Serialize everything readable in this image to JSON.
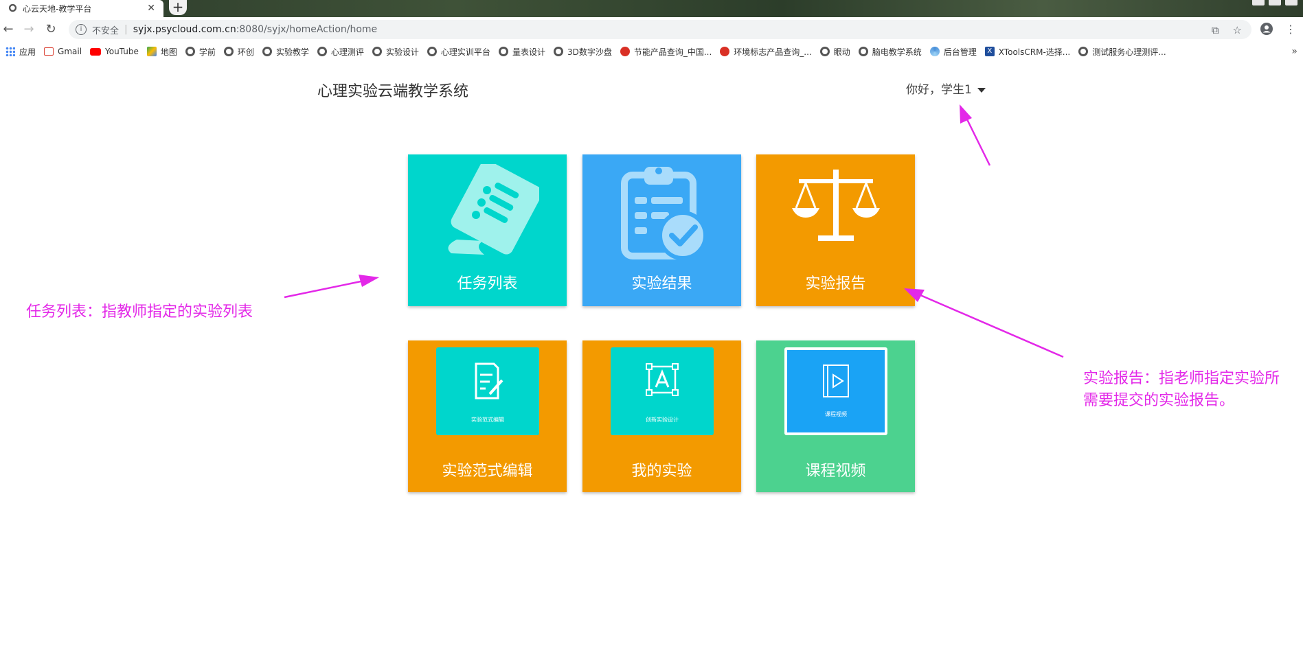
{
  "browser": {
    "tab_title": "心云天地-教学平台",
    "tab_close": "✕",
    "new_tab": "+",
    "address": {
      "security_label": "不安全",
      "url_host": "syjx.psycloud.com.cn",
      "url_path": ":8080/syjx/homeAction/home"
    },
    "bookmarks": [
      {
        "label": "应用",
        "icon": "apps-grid-icon"
      },
      {
        "label": "Gmail",
        "icon": "gmail-icon"
      },
      {
        "label": "YouTube",
        "icon": "youtube-icon"
      },
      {
        "label": "地图",
        "icon": "maps-icon"
      },
      {
        "label": "学前",
        "icon": "globe-icon"
      },
      {
        "label": "环创",
        "icon": "globe-icon"
      },
      {
        "label": "实验教学",
        "icon": "globe-icon"
      },
      {
        "label": "心理测评",
        "icon": "globe-icon"
      },
      {
        "label": "实验设计",
        "icon": "globe-icon"
      },
      {
        "label": "心理实训平台",
        "icon": "globe-icon"
      },
      {
        "label": "量表设计",
        "icon": "globe-icon"
      },
      {
        "label": "3D数字沙盘",
        "icon": "globe-icon"
      },
      {
        "label": "节能产品查询_中国...",
        "icon": "emblem-icon"
      },
      {
        "label": "环境标志产品查询_...",
        "icon": "emblem-icon"
      },
      {
        "label": "眼动",
        "icon": "globe-icon"
      },
      {
        "label": "脑电教学系统",
        "icon": "globe-icon"
      },
      {
        "label": "后台管理",
        "icon": "swirl-icon"
      },
      {
        "label": "XToolsCRM-选择...",
        "icon": "xtools-icon"
      },
      {
        "label": "测试服务心理测评...",
        "icon": "globe-icon"
      }
    ],
    "bookmarks_more": "»"
  },
  "header": {
    "site_title": "心理实验云端教学系统",
    "user_greeting": "你好，学生1"
  },
  "tiles": [
    {
      "label": "任务列表",
      "color": "#00d6cc",
      "icon": "task-list-icon"
    },
    {
      "label": "实验结果",
      "color": "#3aa8f5",
      "icon": "clipboard-check-icon"
    },
    {
      "label": "实验报告",
      "color": "#f39a00",
      "icon": "balance-scale-icon"
    },
    {
      "label": "实验范式编辑",
      "color": "#f39a00",
      "icon": "edit-document-icon",
      "card_caption": "实验范式编辑",
      "card_color": "#00d6cc"
    },
    {
      "label": "我的实验",
      "color": "#f39a00",
      "icon": "create-experiment-icon",
      "card_caption": "创新实验设计",
      "card_color": "#00d6cc"
    },
    {
      "label": "课程视频",
      "color": "#4cd28f",
      "icon": "video-play-icon",
      "card_caption": "课程视频",
      "card_color": "#1aa3f5"
    }
  ],
  "annotations": {
    "left": "任务列表：指教师指定的实验列表",
    "right_line1": "实验报告：指老师指定实验所",
    "right_line2": "需要提交的实验报告。",
    "color": "#e328e8"
  }
}
